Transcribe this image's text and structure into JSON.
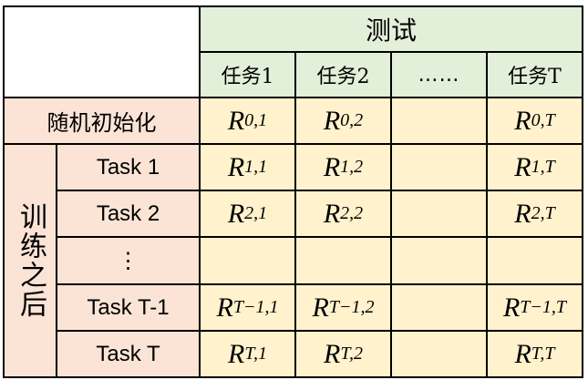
{
  "header": {
    "test_title": "测试"
  },
  "columns": [
    "任务1",
    "任务2",
    "……",
    "任务T"
  ],
  "random_init": {
    "label": "随机初始化",
    "cells": [
      {
        "base": "R",
        "sub": "0,1"
      },
      {
        "base": "R",
        "sub": "0,2"
      },
      {
        "base": "",
        "sub": ""
      },
      {
        "base": "R",
        "sub": "0,T"
      }
    ]
  },
  "after_training": {
    "label": "训练之后",
    "rows": [
      {
        "task": "Task 1",
        "cells": [
          {
            "base": "R",
            "sub": "1,1"
          },
          {
            "base": "R",
            "sub": "1,2"
          },
          {
            "base": "",
            "sub": ""
          },
          {
            "base": "R",
            "sub": "1,T"
          }
        ]
      },
      {
        "task": "Task 2",
        "cells": [
          {
            "base": "R",
            "sub": "2,1"
          },
          {
            "base": "R",
            "sub": "2,2"
          },
          {
            "base": "",
            "sub": ""
          },
          {
            "base": "R",
            "sub": "2,T"
          }
        ]
      },
      {
        "task": "⋮",
        "cells": [
          {
            "base": "",
            "sub": ""
          },
          {
            "base": "",
            "sub": ""
          },
          {
            "base": "",
            "sub": ""
          },
          {
            "base": "",
            "sub": ""
          }
        ]
      },
      {
        "task": "Task T-1",
        "cells": [
          {
            "base": "R",
            "sub": "T−1,1"
          },
          {
            "base": "R",
            "sub": "T−1,2"
          },
          {
            "base": "",
            "sub": ""
          },
          {
            "base": "R",
            "sub": "T−1,T"
          }
        ]
      },
      {
        "task": "Task T",
        "cells": [
          {
            "base": "R",
            "sub": "T,1"
          },
          {
            "base": "R",
            "sub": "T,2"
          },
          {
            "base": "",
            "sub": ""
          },
          {
            "base": "R",
            "sub": "T,T"
          }
        ]
      }
    ]
  },
  "colors": {
    "header_green": "#e2efd9",
    "row_salmon": "#fbe4d6",
    "cell_yellow": "#fff2cc",
    "border": "#000000"
  }
}
